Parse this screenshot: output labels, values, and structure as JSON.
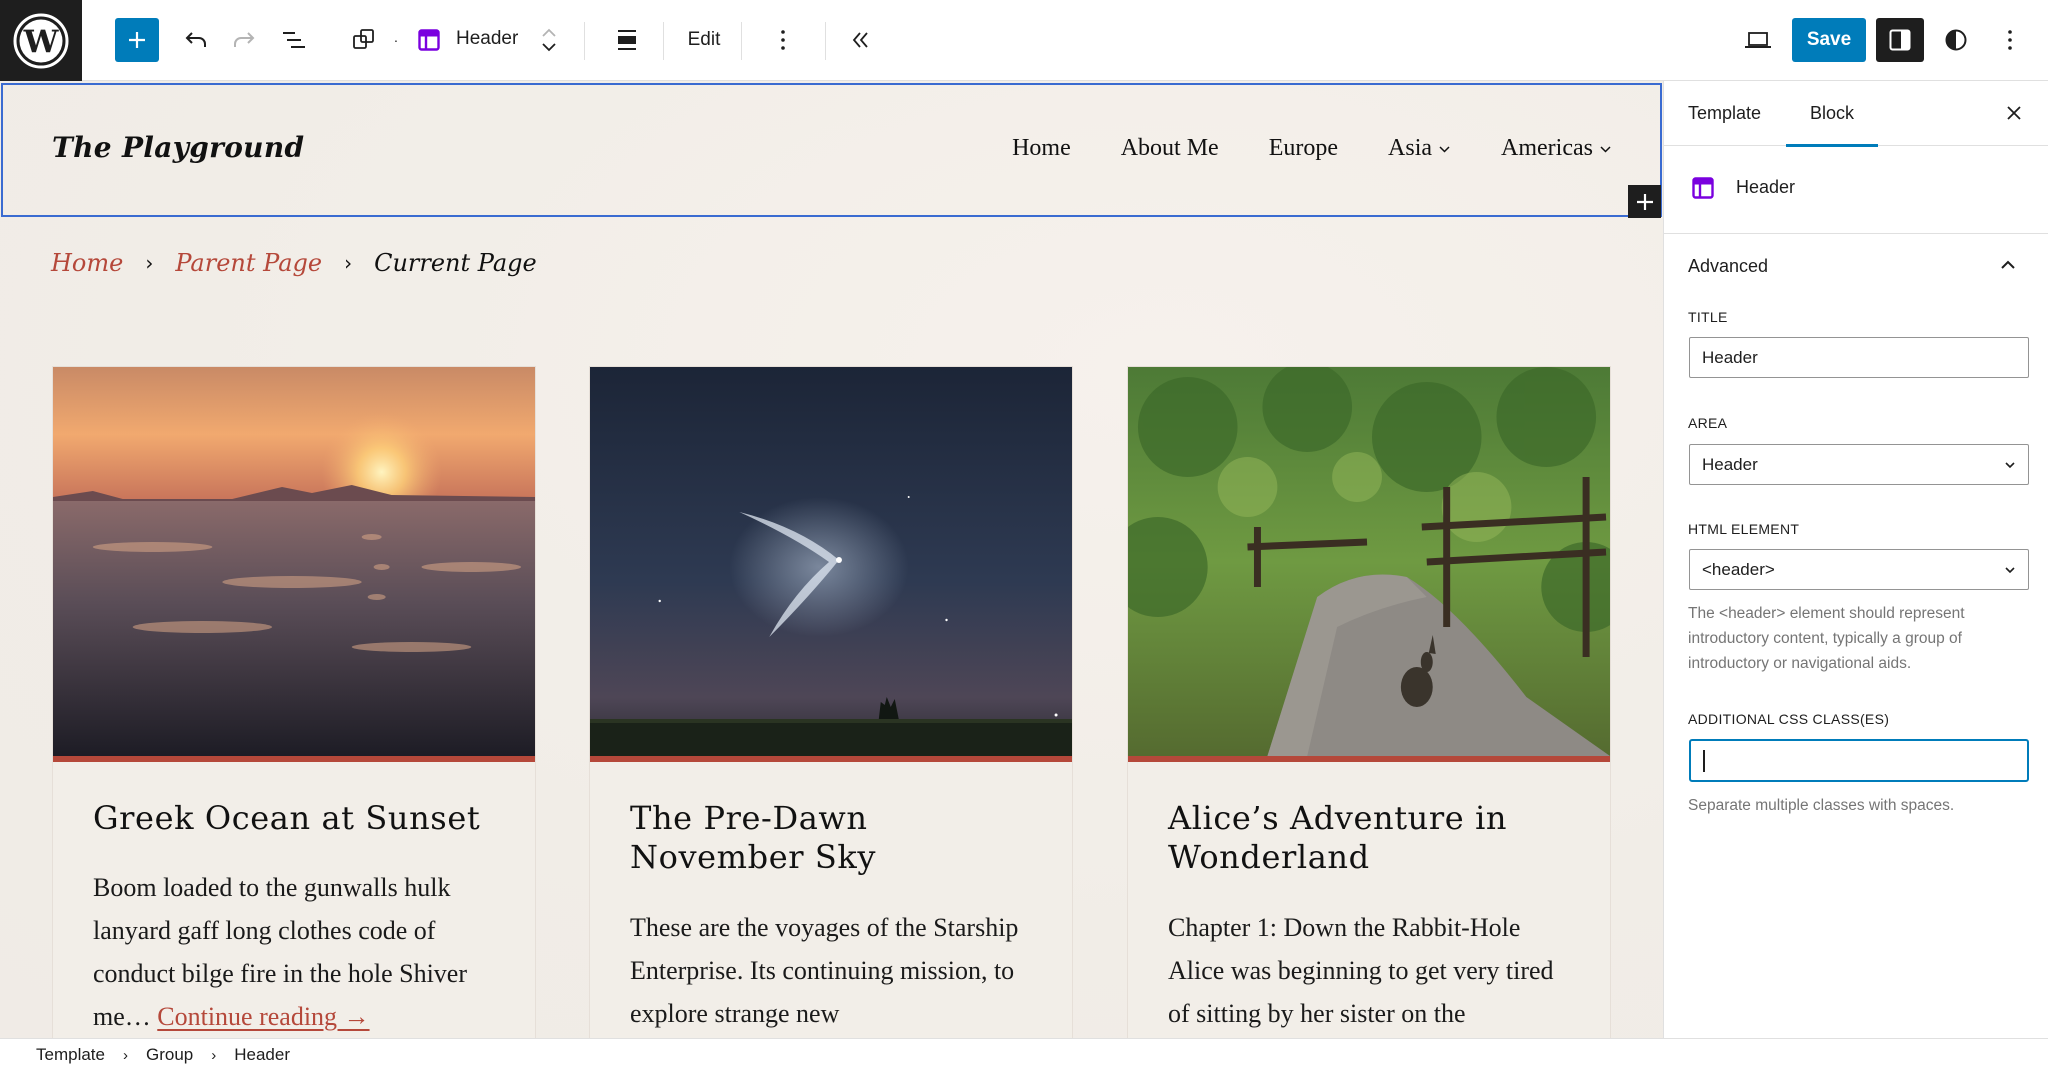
{
  "toolbar": {
    "logo": "wordpress-logo",
    "add_block_label": "+",
    "block_type_name": "Header",
    "edit_label": "Edit",
    "save_label": "Save",
    "icons": {
      "undo": "undo-icon",
      "redo": "redo-icon",
      "list_view": "list-view-icon",
      "block_transform": "duplicate-blocks-icon",
      "template_part": "template-part-header-icon",
      "move": "move-up-down-icon",
      "align": "full-width-align-icon",
      "options": "more-vertical-icon",
      "collapse": "chevrons-left-icon",
      "preview": "laptop-icon",
      "settings": "sidebar-settings-icon",
      "styles": "half-circle-styles-icon",
      "options_global": "more-vertical-icon"
    }
  },
  "canvas": {
    "site_title": "The Playground",
    "nav": [
      {
        "label": "Home",
        "has_submenu": false
      },
      {
        "label": "About Me",
        "has_submenu": false
      },
      {
        "label": "Europe",
        "has_submenu": false
      },
      {
        "label": "Asia",
        "has_submenu": true
      },
      {
        "label": "Americas",
        "has_submenu": true
      }
    ],
    "breadcrumbs": [
      {
        "label": "Home",
        "link": true
      },
      {
        "label": "Parent Page",
        "link": true
      },
      {
        "label": "Current Page",
        "link": false
      }
    ],
    "breadcrumb_separator": "›",
    "accent_color": "#b5483a",
    "selection_color": "#3a6bd1",
    "posts": [
      {
        "title": "Greek Ocean at Sunset",
        "excerpt": "Boom loaded to the gunwalls hulk lanyard gaff long clothes code of conduct bilge fire in the hole Shiver me…",
        "read_more": "Continue reading →",
        "image": "sunset-over-ocean-waves"
      },
      {
        "title": "The Pre-Dawn November Sky",
        "excerpt": "These are the voyages of the Starship Enterprise. Its continuing mission, to explore strange new",
        "read_more": "",
        "image": "rocket-plume-in-night-sky"
      },
      {
        "title": "Alice’s Adventure in Wonderland",
        "excerpt": "Chapter 1: Down the Rabbit-Hole Alice was beginning to get very tired of sitting by her sister on the",
        "read_more": "",
        "image": "rabbit-on-forest-path"
      }
    ]
  },
  "sidebar": {
    "tabs": [
      {
        "label": "Template",
        "active": false
      },
      {
        "label": "Block",
        "active": true
      }
    ],
    "block_name": "Header",
    "panel_title": "Advanced",
    "fields": {
      "title": {
        "label": "Title",
        "value": "Header"
      },
      "area": {
        "label": "Area",
        "value": "Header"
      },
      "html_element": {
        "label": "HTML element",
        "value": "<header>",
        "help": "The <header> element should represent introductory content, typically a group of introductory or navigational aids."
      },
      "css_classes": {
        "label": "Additional CSS class(es)",
        "value": "",
        "help": "Separate multiple classes with spaces."
      }
    }
  },
  "footer": {
    "breadcrumbs": [
      "Template",
      "Group",
      "Header"
    ],
    "separator": "›"
  }
}
